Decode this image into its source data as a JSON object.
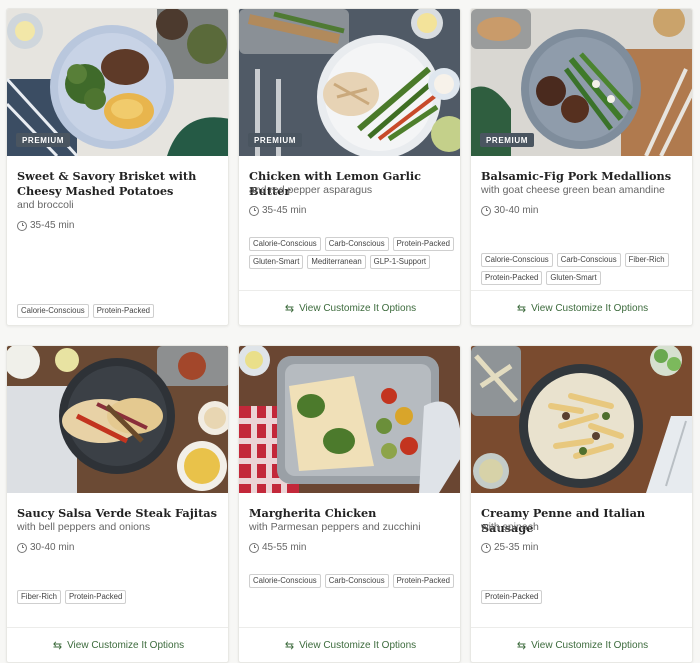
{
  "badge_label": "PREMIUM",
  "options_label": "View Customize It Options",
  "cards": [
    {
      "title": "Sweet & Savory Brisket with Cheesy Mashed Potatoes",
      "subtitle": "and broccoli",
      "time": "35-45 min",
      "premium": true,
      "tags": [
        "Calorie-Conscious",
        "Protein-Packed"
      ],
      "has_options": false
    },
    {
      "title": "Chicken with Lemon Garlic Butter",
      "subtitle": "and red pepper asparagus",
      "time": "35-45 min",
      "premium": true,
      "tags": [
        "Calorie-Conscious",
        "Carb-Conscious",
        "Protein-Packed",
        "Gluten-Smart",
        "Mediterranean",
        "GLP-1-Support"
      ],
      "has_options": true
    },
    {
      "title": "Balsamic-Fig Pork Medallions",
      "subtitle": "with goat cheese green bean amandine",
      "time": "30-40 min",
      "premium": true,
      "tags": [
        "Calorie-Conscious",
        "Carb-Conscious",
        "Fiber-Rich",
        "Protein-Packed",
        "Gluten-Smart"
      ],
      "has_options": true
    },
    {
      "title": "Saucy Salsa Verde Steak Fajitas",
      "subtitle": "with bell peppers and onions",
      "time": "30-40 min",
      "premium": false,
      "tags": [
        "Fiber-Rich",
        "Protein-Packed"
      ],
      "has_options": true
    },
    {
      "title": "Margherita Chicken",
      "subtitle": "with Parmesan peppers and zucchini",
      "time": "45-55 min",
      "premium": false,
      "tags": [
        "Calorie-Conscious",
        "Carb-Conscious",
        "Protein-Packed"
      ],
      "has_options": true
    },
    {
      "title": "Creamy Penne and Italian Sausage",
      "subtitle": "with spinach",
      "time": "25-35 min",
      "premium": false,
      "tags": [
        "Protein-Packed"
      ],
      "has_options": true
    }
  ],
  "icons": {
    "time": "clock-icon",
    "options": "swap-arrows-icon"
  },
  "colors": {
    "badge_bg": "#4a5560",
    "link_green": "#3d6b3d"
  }
}
